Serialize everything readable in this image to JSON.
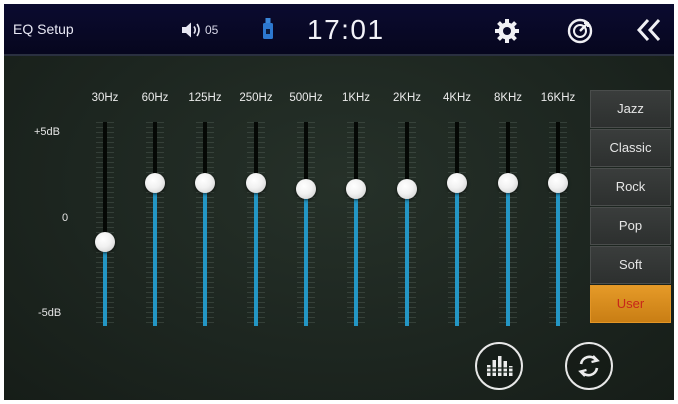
{
  "header": {
    "title": "EQ Setup",
    "volume_icon": "speaker-icon",
    "volume_value": "05",
    "usb_icon": "usb-icon",
    "clock": "17:01",
    "settings_icon": "gear-icon",
    "nav_icon": "navigation-icon",
    "back_icon": "double-chevron-left-icon"
  },
  "scale": {
    "plus": "+5dB",
    "zero": "0",
    "minus": "-5dB"
  },
  "bands": [
    {
      "label": "30Hz",
      "level": 0.41
    },
    {
      "label": "60Hz",
      "level": 0.7
    },
    {
      "label": "125Hz",
      "level": 0.7
    },
    {
      "label": "250Hz",
      "level": 0.7
    },
    {
      "label": "500Hz",
      "level": 0.67
    },
    {
      "label": "1KHz",
      "level": 0.67
    },
    {
      "label": "2KHz",
      "level": 0.67
    },
    {
      "label": "4KHz",
      "level": 0.7
    },
    {
      "label": "8KHz",
      "level": 0.7
    },
    {
      "label": "16KHz",
      "level": 0.7
    }
  ],
  "presets": [
    {
      "label": "Jazz",
      "active": false
    },
    {
      "label": "Classic",
      "active": false
    },
    {
      "label": "Rock",
      "active": false
    },
    {
      "label": "Pop",
      "active": false
    },
    {
      "label": "Soft",
      "active": false
    },
    {
      "label": "User",
      "active": true
    }
  ],
  "footer": {
    "eq_button_icon": "equalizer-bars-icon",
    "reset_button_icon": "refresh-icon"
  },
  "colors": {
    "accent_fill": "#2496c4",
    "active_preset": "#e59a28",
    "active_preset_text": "#c8261a"
  }
}
